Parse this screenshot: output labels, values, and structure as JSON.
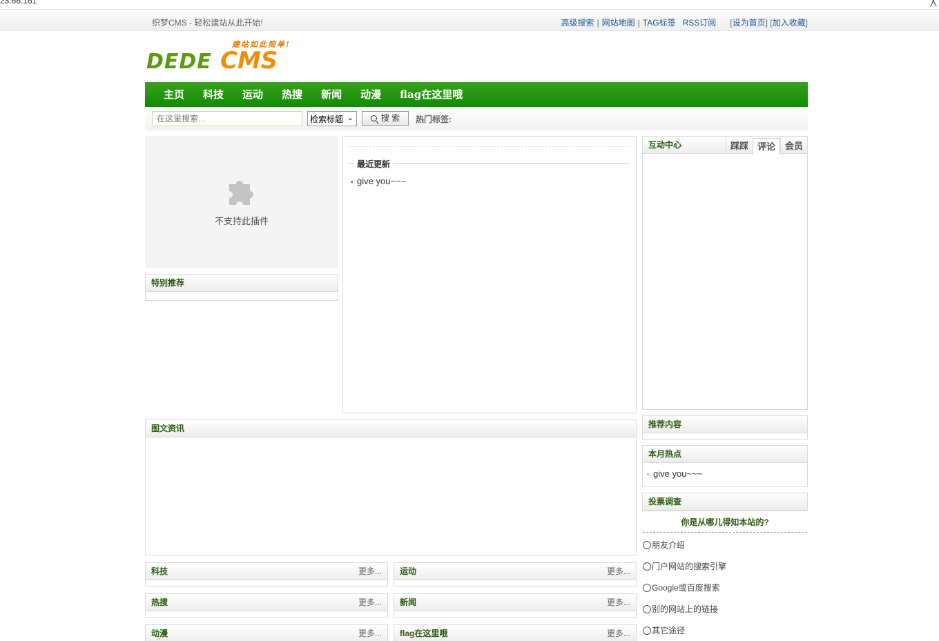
{
  "browser": {
    "address_fragment": "23.66.161",
    "close_glyph": "╳"
  },
  "topbar": {
    "slogan": "织梦CMS - 轻松建站从此开始!",
    "links": [
      "高级搜索",
      "网站地图",
      "TAG标签",
      "RSS订阅"
    ],
    "set_home": "设为首页",
    "add_fav": "加入收藏"
  },
  "logo": {
    "text_left": "DEDE",
    "text_right": "CMS",
    "tagline": "建站如此简单!"
  },
  "nav": {
    "items": [
      "主页",
      "科技",
      "运动",
      "热搜",
      "新闻",
      "动漫",
      "flag在这里哦"
    ]
  },
  "search": {
    "placeholder": "在这里搜索...",
    "select_value": "检索标题",
    "button": "搜 索",
    "hot_tags_label": "热门标签:"
  },
  "flash": {
    "unsupported": "不支持此插件"
  },
  "special": {
    "title": "特别推荐"
  },
  "recent": {
    "title": "最近更新",
    "items": [
      "give you~~~"
    ]
  },
  "interact": {
    "title": "互动中心",
    "tabs": [
      "踩踩",
      "评论",
      "会员"
    ],
    "active_tab": "评论"
  },
  "recommend": {
    "title": "推荐内容"
  },
  "monthly_hot": {
    "title": "本月热点",
    "items": [
      "give you~~~"
    ]
  },
  "poll": {
    "title": "投票调查",
    "question": "你是从哪儿得知本站的?",
    "options": [
      "朋友介绍",
      "门户网站的搜索引擎",
      "Google或百度搜索",
      "别的网站上的链接",
      "其它途径"
    ]
  },
  "image_news": {
    "title": "图文资讯"
  },
  "categories": [
    {
      "title": "科技",
      "more": "更多..."
    },
    {
      "title": "运动",
      "more": "更多..."
    },
    {
      "title": "热搜",
      "more": "更多..."
    },
    {
      "title": "新闻",
      "more": "更多..."
    },
    {
      "title": "动漫",
      "more": "更多..."
    },
    {
      "title": "flag在这里哦",
      "more": "更多..."
    }
  ],
  "colors": {
    "nav_green": "#148a05",
    "title_green": "#2e5b12",
    "link_blue": "#1e5494",
    "logo_orange": "#f08d0b"
  }
}
